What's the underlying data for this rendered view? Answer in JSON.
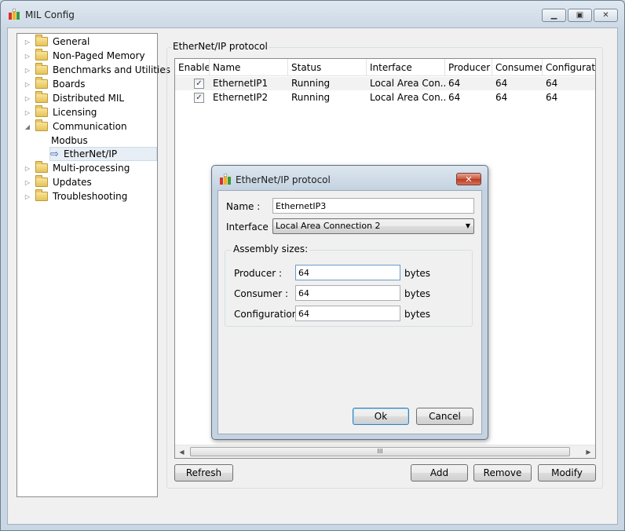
{
  "window": {
    "title": "MIL Config",
    "minimize_glyph": "▁",
    "maximize_glyph": "▣",
    "close_glyph": "✕"
  },
  "tree": {
    "items": [
      {
        "label": "General",
        "arrow": "▷"
      },
      {
        "label": "Non-Paged Memory",
        "arrow": "▷"
      },
      {
        "label": "Benchmarks and Utilities",
        "arrow": "▷"
      },
      {
        "label": "Boards",
        "arrow": "▷"
      },
      {
        "label": "Distributed MIL",
        "arrow": "▷"
      },
      {
        "label": "Licensing",
        "arrow": "▷"
      },
      {
        "label": "Communication",
        "arrow": "◢"
      },
      {
        "label": "Modbus"
      },
      {
        "label": "EtherNet/IP",
        "selected": true
      },
      {
        "label": "Multi-processing",
        "arrow": "▷"
      },
      {
        "label": "Updates",
        "arrow": "▷"
      },
      {
        "label": "Troubleshooting",
        "arrow": "▷"
      }
    ]
  },
  "group": {
    "title": "EtherNet/IP protocol"
  },
  "table": {
    "columns": [
      "Enable",
      "Name",
      "Status",
      "Interface",
      "Producer",
      "Consumer",
      "Configuratio"
    ],
    "rows": [
      {
        "enabled": "✓",
        "name": "EthernetIP1",
        "status": "Running",
        "interface": "Local Area Con...",
        "producer": "64",
        "consumer": "64",
        "configuration": "64"
      },
      {
        "enabled": "✓",
        "name": "EthernetIP2",
        "status": "Running",
        "interface": "Local Area Con...",
        "producer": "64",
        "consumer": "64",
        "configuration": "64"
      }
    ],
    "scroll_left": "◀",
    "scroll_right": "▶",
    "scroll_grip": "III"
  },
  "buttons": {
    "refresh": "Refresh",
    "add": "Add",
    "remove": "Remove",
    "modify": "Modify"
  },
  "dialog": {
    "title": "EtherNet/IP protocol",
    "close_glyph": "✕",
    "name_label": "Name :",
    "name_value": "EthernetIP3",
    "interface_label": "Interface :",
    "interface_value": "Local Area Connection 2",
    "caret": "▼",
    "assembly_label": "Assembly sizes:",
    "producer_label": "Producer :",
    "producer_value": "64",
    "consumer_label": "Consumer :",
    "consumer_value": "64",
    "configuration_label": "Configuration :",
    "configuration_value": "64",
    "unit": "bytes",
    "ok": "Ok",
    "cancel": "Cancel"
  },
  "colors": {
    "accent": "#2a63b5",
    "close_button": "#c9553f"
  }
}
